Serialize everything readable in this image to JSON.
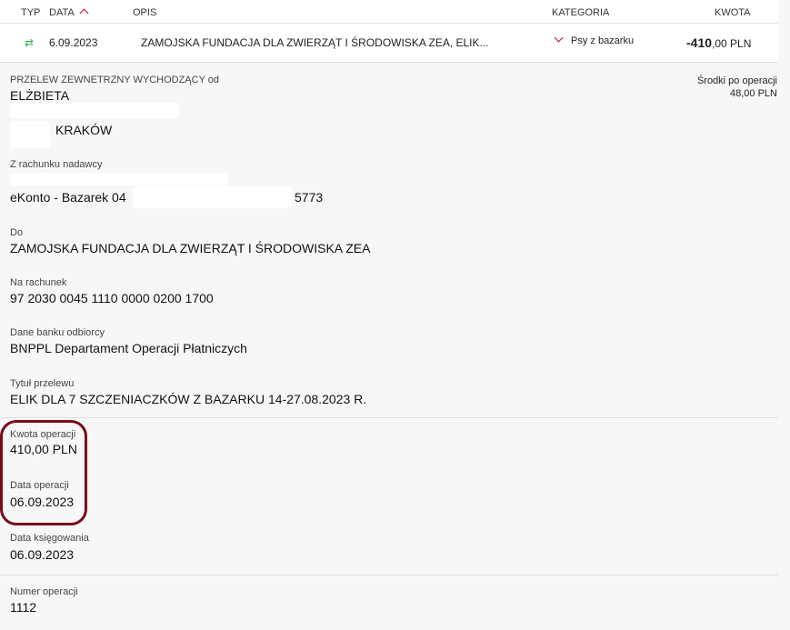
{
  "header": {
    "col_type": "TYP",
    "col_date": "DATA",
    "col_desc": "OPIS",
    "col_category": "KATEGORIA",
    "col_amount": "KWOTA"
  },
  "transaction": {
    "type_icon": "transfer-arrows-icon",
    "date": "6.09.2023",
    "description": "ZAMOJSKA FUNDACJA DLA ZWIERZĄT I ŚRODOWISKA ZEA, ELIK...",
    "category": "Psy z bazarku",
    "amount_int": "-410",
    "amount_dec": ",00 PLN"
  },
  "details": {
    "transfer_type": "PRZELEW ZEWNETRZNY WYCHODZĄCY od",
    "sender_name": "ELŻBIETA",
    "sender_city": "KRAKÓW",
    "balance_label": "Środki po operacji",
    "balance_value": "48,00 PLN",
    "from_account_label": "Z rachunku nadawcy",
    "from_account_prefix": "eKonto - Bazarek 04",
    "from_account_suffix": "5773",
    "to_label": "Do",
    "to_value": "ZAMOJSKA FUNDACJA DLA ZWIERZĄT I ŚRODOWISKA ZEA",
    "account_label": "Na rachunek",
    "account_value": "97 2030 0045 1110 0000 0200 1700",
    "bank_label": "Dane banku odbiorcy",
    "bank_value": "BNPPL Departament Operacji Płatniczych",
    "title_label": "Tytuł przelewu",
    "title_value": "ELIK DLA 7 SZCZENIACZKÓW Z BAZARKU 14-27.08.2023 R.",
    "op_amount_label": "Kwota operacji",
    "op_amount_value": "410,00 PLN",
    "op_date_label": "Data operacji",
    "op_date_value": "06.09.2023",
    "booking_date_label": "Data księgowania",
    "booking_date_value": "06.09.2023",
    "op_number_label": "Numer operacji",
    "op_number_value": "1112"
  },
  "colors": {
    "accent": "#d4001a",
    "highlight": "#7a0a1a",
    "transfer_icon": "#2bb34a"
  }
}
